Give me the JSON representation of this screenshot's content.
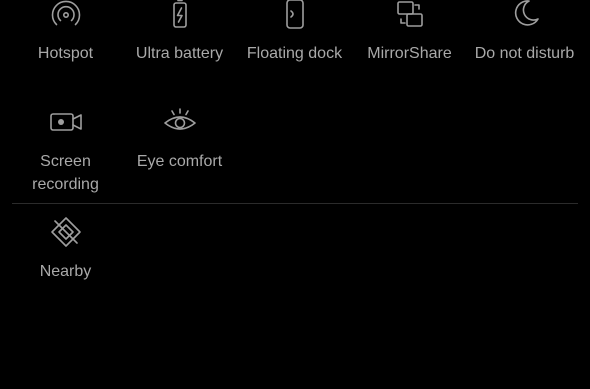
{
  "tiles_row1": [
    {
      "label": "Hotspot",
      "icon": "hotspot-icon"
    },
    {
      "label": "Ultra battery",
      "icon": "battery-bolt-icon"
    },
    {
      "label": "Floating dock",
      "icon": "floating-dock-icon"
    },
    {
      "label": "MirrorShare",
      "icon": "mirror-share-icon"
    },
    {
      "label": "Do not disturb",
      "icon": "moon-icon"
    }
  ],
  "tiles_row2": [
    {
      "label": "Screen recording",
      "icon": "video-camera-icon"
    },
    {
      "label": "Eye comfort",
      "icon": "eye-icon"
    }
  ],
  "tiles_extra": [
    {
      "label": "Nearby",
      "icon": "nearby-icon"
    }
  ],
  "colors": {
    "background": "#000000",
    "icon": "#9e9e9e",
    "label": "#a9a9a9",
    "divider": "#2b2b2b"
  }
}
